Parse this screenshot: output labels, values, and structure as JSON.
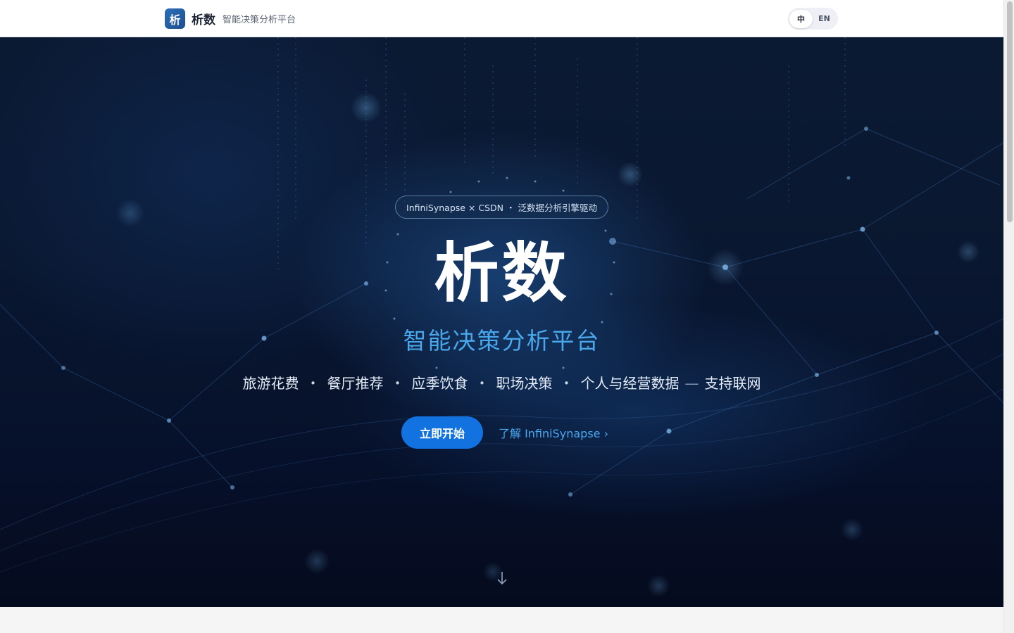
{
  "header": {
    "logo_char": "析",
    "brand_name": "析数",
    "brand_subtitle": "智能决策分析平台",
    "lang_options": [
      "中",
      "EN"
    ],
    "lang_active": "中"
  },
  "hero": {
    "badge": "InfiniSynapse × CSDN ・ 泛数据分析引擎驱动",
    "title": "析数",
    "subtitle": "智能决策分析平台",
    "features": [
      "旅游花费",
      "餐厅推荐",
      "应季饮食",
      "职场决策",
      "个人与经营数据"
    ],
    "features_separator": "・",
    "features_dash": "—",
    "features_tail": "支持联网",
    "cta_label": "立即开始",
    "learn_label": "了解 InfiniSynapse ›"
  },
  "colors": {
    "accent": "#1172e0",
    "subtitle": "#49a8ec",
    "hero_bg": "#0a1730"
  },
  "icons": {
    "scroll": "arrow-down-icon"
  }
}
